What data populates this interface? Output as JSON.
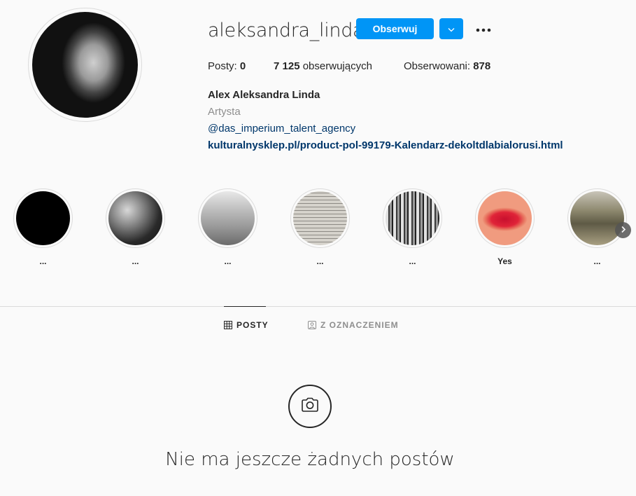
{
  "profile": {
    "username": "aleksandra_linda",
    "follow_label": "Obserwuj",
    "stats": {
      "posts_label": "Posty: ",
      "posts_value": "0",
      "followers_value": "7 125",
      "followers_label": " obserwujących",
      "following_label": "Obserwowani: ",
      "following_value": "878"
    },
    "full_name": "Alex Aleksandra Linda",
    "category": "Artysta",
    "bio_mention": "@das_imperium_talent_agency",
    "website": "kulturalnysklep.pl/product-pol-99179-Kalendarz-dekoltdlabialorusi.html"
  },
  "highlights": [
    {
      "label": "...",
      "style": "black"
    },
    {
      "label": "...",
      "style": "bw-hand"
    },
    {
      "label": "...",
      "style": "grey-fog"
    },
    {
      "label": "...",
      "style": "book-text"
    },
    {
      "label": "...",
      "style": "bw-trees"
    },
    {
      "label": "Yes",
      "style": "red-lips"
    },
    {
      "label": "...",
      "style": "group-photo"
    }
  ],
  "tabs": [
    {
      "label": "POSTY",
      "icon": "grid-icon",
      "active": true
    },
    {
      "label": "Z OZNACZENIEM",
      "icon": "tagged-icon",
      "active": false
    }
  ],
  "empty_state": {
    "icon": "camera-icon",
    "text": "Nie ma jeszcze żadnych postów"
  },
  "colors": {
    "accent": "#0095f6",
    "link": "#00376b",
    "muted": "#8e8e8e",
    "background": "#fafafa"
  }
}
